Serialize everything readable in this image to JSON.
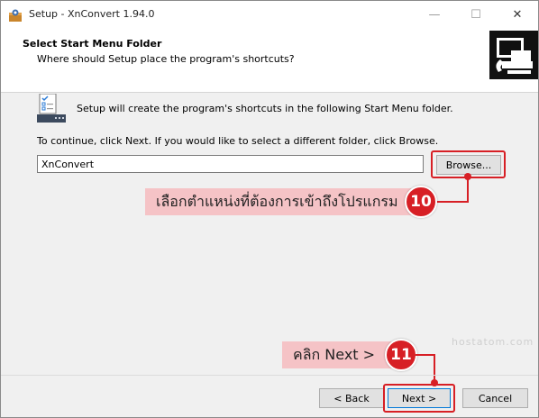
{
  "window": {
    "title": "Setup - XnConvert 1.94.0",
    "controls": {
      "minimize": "—",
      "maximize": "☐",
      "close": "✕"
    }
  },
  "header": {
    "title": "Select Start Menu Folder",
    "subtitle": "Where should Setup place the program's shortcuts?"
  },
  "body": {
    "info_text": "Setup will create the program's shortcuts in the following Start Menu folder.",
    "instruction": "To continue, click Next. If you would like to select a different folder, click Browse.",
    "folder_value": "XnConvert",
    "browse_label": "Browse..."
  },
  "annotations": {
    "step10": {
      "number": "10",
      "text": "เลือกตำแหน่งที่ต้องการเข้าถึงโปรแกรม"
    },
    "step11": {
      "number": "11",
      "text": "คลิก Next >"
    },
    "accent_color": "#d71f25",
    "callout_color": "#f5c3c6"
  },
  "watermark": "hostatom.com",
  "footer": {
    "back_label": "< Back",
    "next_label": "Next >",
    "cancel_label": "Cancel"
  }
}
